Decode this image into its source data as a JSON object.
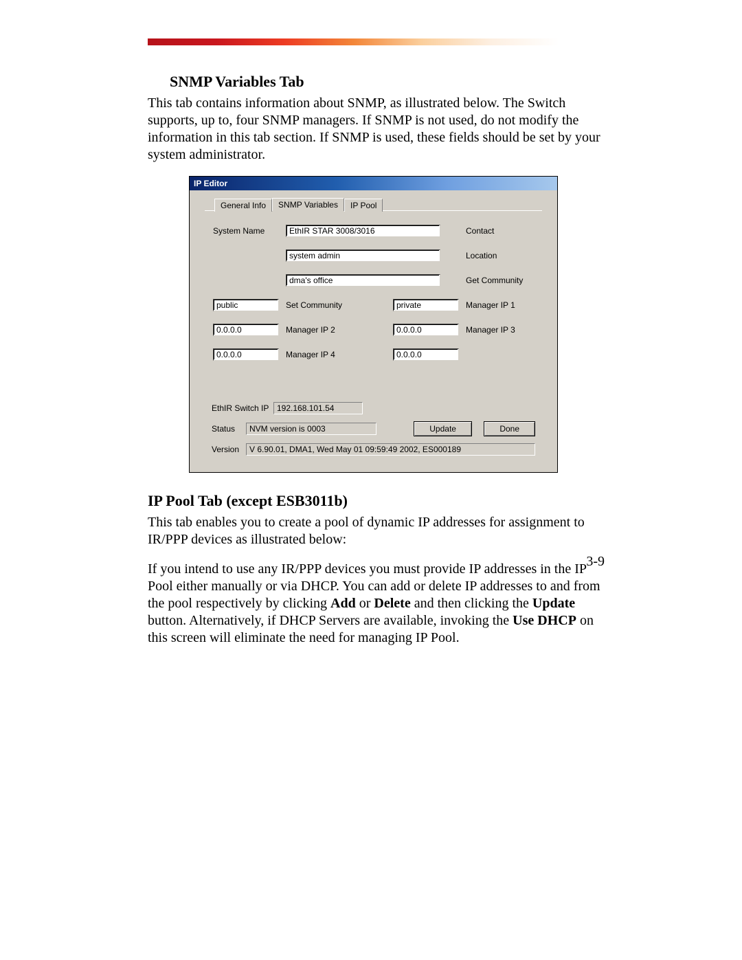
{
  "doc": {
    "heading1": "SNMP Variables Tab",
    "para1": "This tab contains information about SNMP, as illustrated below.  The Switch supports, up to, four SNMP managers.  If SNMP is not used, do not modify the information in this tab section.  If SNMP is used, these fields should be set by your system administrator.",
    "heading2": "IP Pool Tab (except ESB3011b)",
    "para2": "This tab enables you to create a pool of dynamic IP addresses for assignment to IR/PPP devices as illustrated below:",
    "para3_pre": "If you intend to use any IR/PPP devices you must provide IP addresses in the IP Pool either manually or via DHCP.  You can add or delete IP addresses to and from the pool respectively by clicking ",
    "para3_b1": "Add",
    "para3_mid1": " or ",
    "para3_b2": "Delete",
    "para3_mid2": " and then clicking the ",
    "para3_b3": "Update",
    "para3_mid3": " button.  Alternatively, if DHCP Servers are available, invoking the ",
    "para3_b4": "Use DHCP",
    "para3_post": " on this screen will eliminate the need for managing IP Pool.",
    "page_number": "3-9"
  },
  "dialog": {
    "title": "IP Editor",
    "tabs": {
      "general": "General Info",
      "snmp": "SNMP Variables",
      "ippool": "IP Pool"
    },
    "labels": {
      "system_name": "System Name",
      "contact": "Contact",
      "location": "Location",
      "get_community": "Get Community",
      "set_community": "Set Community",
      "manager_ip1": "Manager IP 1",
      "manager_ip2": "Manager IP 2",
      "manager_ip3": "Manager IP 3",
      "manager_ip4": "Manager IP 4",
      "switch_ip": "EthIR Switch IP",
      "status": "Status",
      "version": "Version"
    },
    "values": {
      "system_name": "EthIR STAR 3008/3016",
      "contact": "system admin",
      "location": "dma's office",
      "get_community": "public",
      "set_community": "private",
      "manager_ip1": "0.0.0.0",
      "manager_ip2": "0.0.0.0",
      "manager_ip3": "0.0.0.0",
      "manager_ip4": "0.0.0.0",
      "switch_ip": "192.168.101.54",
      "status": "NVM version is 0003",
      "version": "V 6.90.01, DMA1, Wed May 01 09:59:49 2002, ES000189"
    },
    "buttons": {
      "update": "Update",
      "done": "Done"
    }
  }
}
